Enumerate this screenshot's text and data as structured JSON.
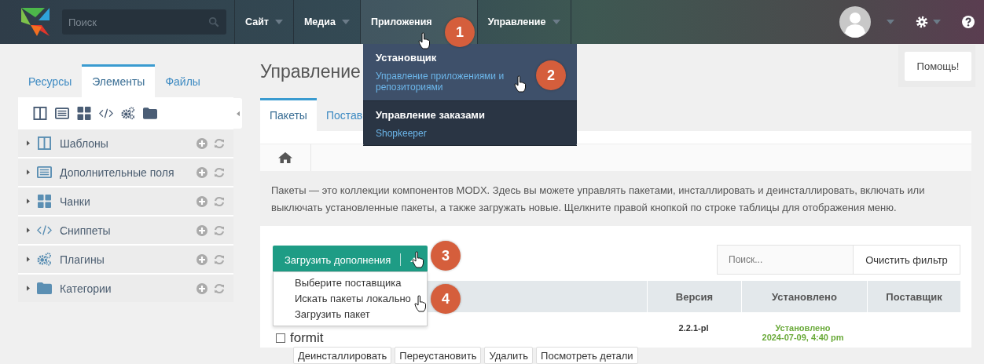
{
  "topbar": {
    "search": {
      "placeholder": "Поиск"
    },
    "nav": [
      {
        "label": "Сайт",
        "selected": false
      },
      {
        "label": "Медиа",
        "selected": false
      },
      {
        "label": "Приложения",
        "selected": true
      },
      {
        "label": "Управление",
        "selected": false
      }
    ]
  },
  "apps_menu": {
    "sections": [
      {
        "title": "Установщик",
        "description": "Управление приложениями и репозиториями",
        "selected": true
      },
      {
        "title": "Управление заказами",
        "description": "Shopkeeper",
        "selected": false
      }
    ]
  },
  "help_button": "Помощь!",
  "sidebar": {
    "tabs": [
      {
        "label": "Ресурсы",
        "selected": false
      },
      {
        "label": "Элементы",
        "selected": true
      },
      {
        "label": "Файлы",
        "selected": false
      }
    ],
    "tree": [
      {
        "kind": "templates",
        "label": "Шаблоны"
      },
      {
        "kind": "fields",
        "label": "Дополнительные поля"
      },
      {
        "kind": "chunks",
        "label": "Чанки"
      },
      {
        "kind": "snippets",
        "label": "Сниппеты"
      },
      {
        "kind": "plugins",
        "label": "Плагины"
      },
      {
        "kind": "categories",
        "label": "Категории"
      }
    ]
  },
  "page": {
    "title": "Управление",
    "tabs": [
      {
        "label": "Пакеты",
        "selected": true
      },
      {
        "label": "Постав",
        "selected": false
      }
    ],
    "description": "Пакеты — это коллекции компонентов MODX. Здесь вы можете управлять пакетами, инсталлировать и деинсталлировать, включать или выключать установленные пакеты, а также загружать новые. Щелкните правой кнопкой по строке таблицы для отображения меню.",
    "download_button": "Загрузить дополнения",
    "download_menu": [
      "Выберите поставщика",
      "Искать пакеты локально",
      "Загрузить пакет"
    ],
    "search": {
      "placeholder": "Поиск..."
    },
    "clear_button": "Очистить фильтр",
    "table": {
      "columns": [
        "Версия",
        "Установлено",
        "Поставщик"
      ],
      "rows": [
        {
          "checked": false,
          "name": "formit",
          "version": "2.2.1-pl",
          "status": "Установлено",
          "date": "2024-07-09, 4:40 pm",
          "actions": [
            "Деинсталлировать",
            "Переустановить",
            "Удалить",
            "Посмотреть детали"
          ]
        }
      ]
    }
  },
  "callouts": [
    "1",
    "2",
    "3",
    "4"
  ]
}
